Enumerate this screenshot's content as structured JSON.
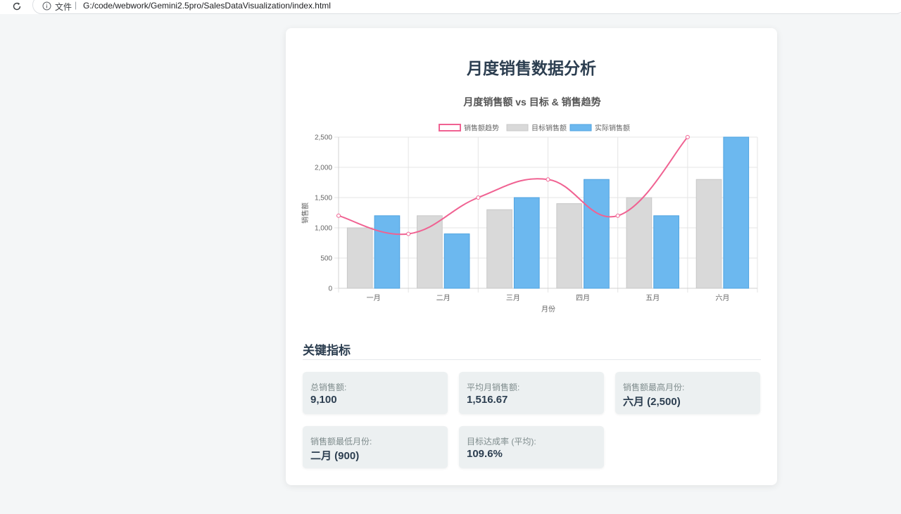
{
  "browser": {
    "address_label": "文件",
    "separator": "|",
    "url": "G:/code/webwork/Gemini2.5pro/SalesDataVisualization/index.html"
  },
  "page": {
    "title": "月度销售数据分析"
  },
  "chart_data": {
    "type": "bar",
    "title": "月度销售额 vs 目标 & 销售趋势",
    "categories": [
      "一月",
      "二月",
      "三月",
      "四月",
      "五月",
      "六月"
    ],
    "series": [
      {
        "name": "销售额趋势",
        "kind": "line",
        "color": "#f06292",
        "values": [
          1200,
          900,
          1500,
          1800,
          1200,
          2500
        ]
      },
      {
        "name": "目标销售额",
        "kind": "bar",
        "color": "#d9d9d9",
        "values": [
          1000,
          1200,
          1300,
          1400,
          1500,
          1800
        ]
      },
      {
        "name": "实际销售额",
        "kind": "bar",
        "color": "#6cb8ef",
        "values": [
          1200,
          900,
          1500,
          1800,
          1200,
          2500
        ]
      }
    ],
    "xlabel": "月份",
    "ylabel": "销售额",
    "ylim": [
      0,
      2500
    ],
    "yticks": [
      0,
      500,
      1000,
      1500,
      2000,
      2500
    ],
    "ytick_labels": [
      "0",
      "500",
      "1,000",
      "1,500",
      "2,000",
      "2,500"
    ],
    "grid": true,
    "legend_position": "top-center"
  },
  "metrics": {
    "heading": "关键指标",
    "items": [
      {
        "label": "总销售额:",
        "value": "9,100"
      },
      {
        "label": "平均月销售额:",
        "value": "1,516.67"
      },
      {
        "label": "销售额最高月份:",
        "value": "六月 (2,500)"
      },
      {
        "label": "销售额最低月份:",
        "value": "二月 (900)"
      },
      {
        "label": "目标达成率 (平均):",
        "value": "109.6%"
      }
    ]
  },
  "colors": {
    "title": "#2c3e50",
    "card_bg": "#ffffff",
    "page_bg": "#f4f6f7",
    "metric_bg": "#ecf0f1"
  }
}
